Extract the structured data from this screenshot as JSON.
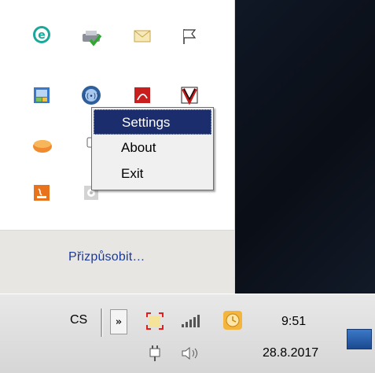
{
  "tray_popup": {
    "icons": [
      {
        "name": "eset-icon"
      },
      {
        "name": "printer-check-icon"
      },
      {
        "name": "mail-icon"
      },
      {
        "name": "flag-icon"
      },
      {
        "name": "control-panel-icon"
      },
      {
        "name": "wireless-icon"
      },
      {
        "name": "acrobat-icon"
      },
      {
        "name": "v-app-icon"
      },
      {
        "name": "pill-icon"
      },
      {
        "name": "usb-plug-icon"
      },
      {
        "name": "java-icon"
      },
      {
        "name": "disk-icon"
      }
    ],
    "customize_label": "Přizpůsobit…"
  },
  "context_menu": {
    "items": [
      {
        "label": "Settings",
        "highlighted": true
      },
      {
        "label": "About",
        "highlighted": false
      },
      {
        "label": "Exit",
        "highlighted": false
      }
    ]
  },
  "taskbar": {
    "language": "CS",
    "chevron": "»",
    "clock": {
      "time": "9:51",
      "date": "28.8.2017"
    }
  },
  "colors": {
    "menu_highlight": "#1c2d6e",
    "link": "#1a3a9a",
    "tray_footer": "#e8e6e3"
  }
}
